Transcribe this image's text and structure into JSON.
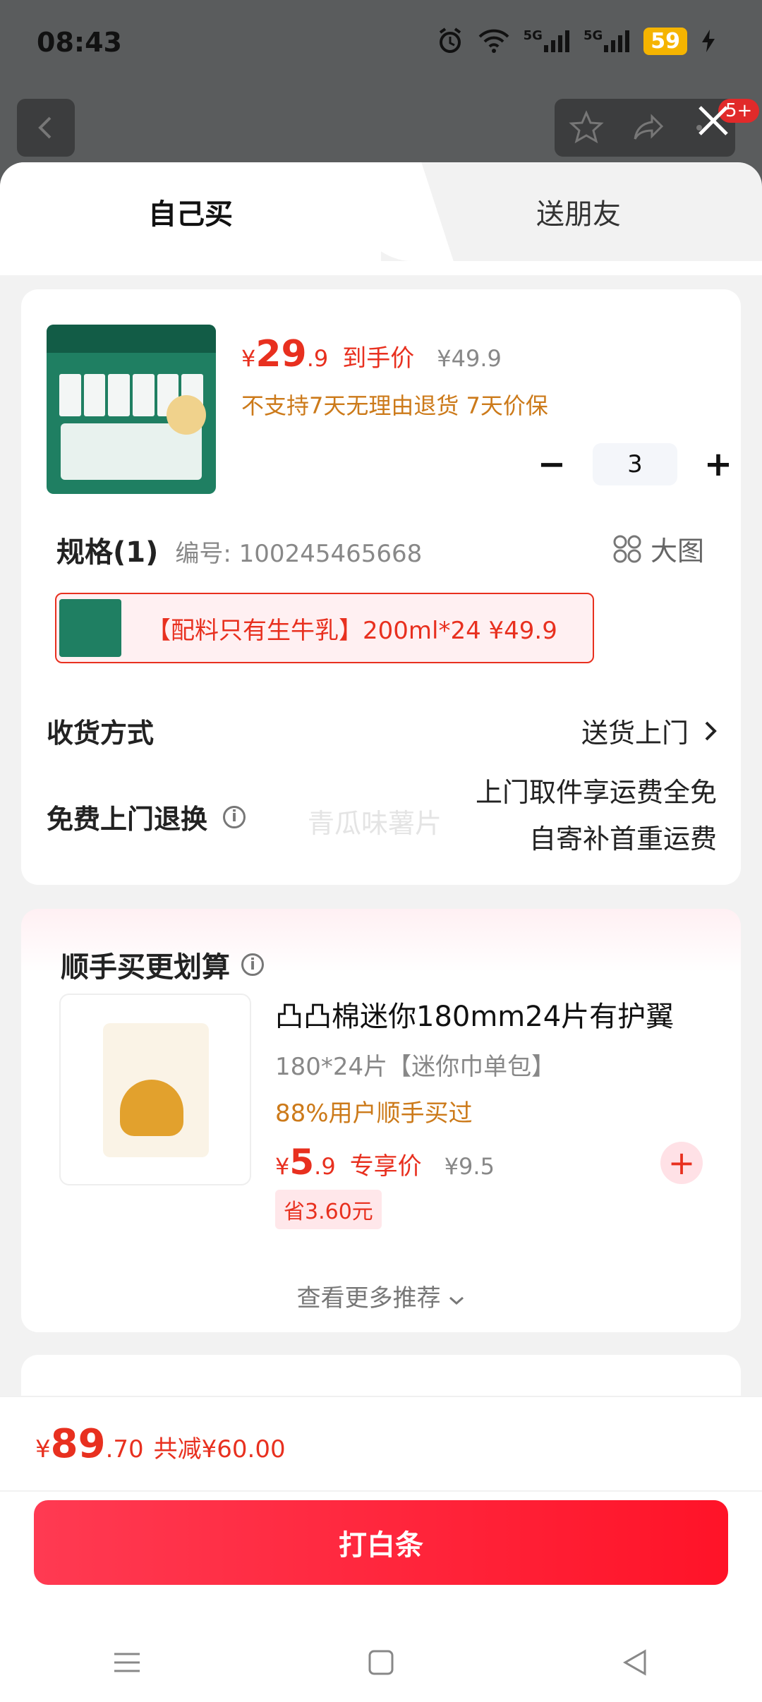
{
  "status_bar": {
    "time": "08:43",
    "battery": "59",
    "net1": "5G",
    "net2": "5G"
  },
  "background": {
    "badge": "5+"
  },
  "tabs": {
    "self": "自己买",
    "friend": "送朋友"
  },
  "product": {
    "price_yen": "¥",
    "price_int": "29",
    "price_dec": ".9",
    "price_tag": "到手价",
    "original_price": "¥49.9",
    "return_note": "不支持7天无理由退货  7天价保",
    "quantity": "3"
  },
  "spec": {
    "title": "规格(1)",
    "code": "编号: 100245465668",
    "big_view": "大图",
    "selected_option": "【配料只有生牛乳】200ml*24  ¥49.9"
  },
  "delivery": {
    "label": "收货方式",
    "value": "送货上门"
  },
  "return_service": {
    "label": "免费上门退换",
    "line1": "上门取件享运费全免",
    "line2": "自寄补首重运费",
    "watermark": "青瓜味薯片"
  },
  "addon": {
    "section_title": "顺手买更划算",
    "name": "凸凸棉迷你180mm24片有护翼",
    "spec": "180*24片【迷你巾单包】",
    "purchase_rate": "88%用户顺手买过",
    "price_yen": "¥",
    "price_int": "5",
    "price_dec": ".9",
    "price_tag": "专享价",
    "original_price": "¥9.5",
    "savings": "省3.60元",
    "more": "查看更多推荐"
  },
  "footer": {
    "total_yen": "¥",
    "total_int": "89",
    "total_dec": ".70",
    "total_saved": "共减¥60.00",
    "pay_button": "打白条"
  },
  "colors": {
    "accent": "#e8301f",
    "button": "#ff1f3a",
    "warning": "#cc7a1a"
  }
}
